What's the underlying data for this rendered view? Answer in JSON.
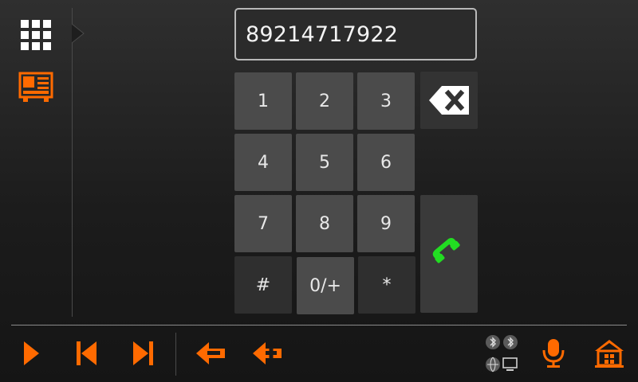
{
  "display": {
    "number": "89214717922"
  },
  "keypad": {
    "keys": [
      "1",
      "2",
      "3",
      "4",
      "5",
      "6",
      "7",
      "8",
      "9",
      "#",
      "0/+",
      "*"
    ]
  },
  "icons": {
    "sidebar": [
      "grid-menu-icon",
      "dialpad-screen-icon"
    ],
    "keypad": [
      "backspace-icon",
      "call-icon"
    ],
    "bottom_bar": [
      "play-icon",
      "previous-track-icon",
      "next-track-icon",
      "volume-down-icon",
      "volume-up-icon",
      "microphone-icon",
      "home-icon"
    ],
    "status": [
      "bluetooth-icon",
      "bluetooth-audio-icon",
      "globe-icon",
      "monitor-icon"
    ]
  },
  "colors": {
    "accent": "#ff6a00",
    "call_green": "#22dd22",
    "key_bg": "#4b4b4b"
  }
}
